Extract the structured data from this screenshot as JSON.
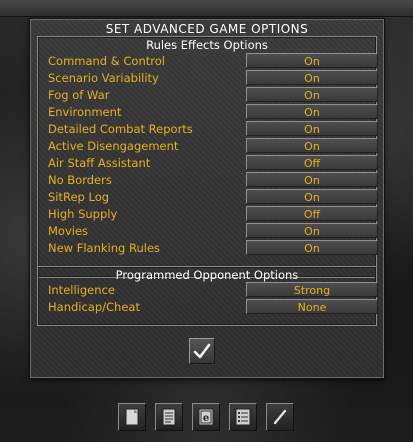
{
  "dialog": {
    "title": "SET ADVANCED GAME OPTIONS",
    "rules_section": {
      "title": "Rules Effects Options",
      "options": [
        {
          "label": "Command & Control",
          "value": "On"
        },
        {
          "label": "Scenario Variability",
          "value": "On"
        },
        {
          "label": "Fog of War",
          "value": "On"
        },
        {
          "label": "Environment",
          "value": "On"
        },
        {
          "label": "Detailed Combat Reports",
          "value": "On"
        },
        {
          "label": "Active Disengagement",
          "value": "On"
        },
        {
          "label": "Air Staff Assistant",
          "value": "Off"
        },
        {
          "label": "No Borders",
          "value": "On"
        },
        {
          "label": "SitRep Log",
          "value": "On"
        },
        {
          "label": "High Supply",
          "value": "Off"
        },
        {
          "label": "Movies",
          "value": "On"
        },
        {
          "label": "New Flanking Rules",
          "value": "On"
        }
      ]
    },
    "opponent_section": {
      "title": "Programmed Opponent Options",
      "options": [
        {
          "label": "Intelligence",
          "value": "Strong"
        },
        {
          "label": "Handicap/Cheat",
          "value": "None"
        }
      ]
    },
    "ok_icon": "checkmark-icon"
  },
  "bottom_toolbar": {
    "icons": [
      "document-icon",
      "notepad-icon",
      "e-page-icon",
      "list-icon",
      "pen-icon"
    ]
  },
  "colors": {
    "label": "#e8b020",
    "title": "#ffffff"
  }
}
